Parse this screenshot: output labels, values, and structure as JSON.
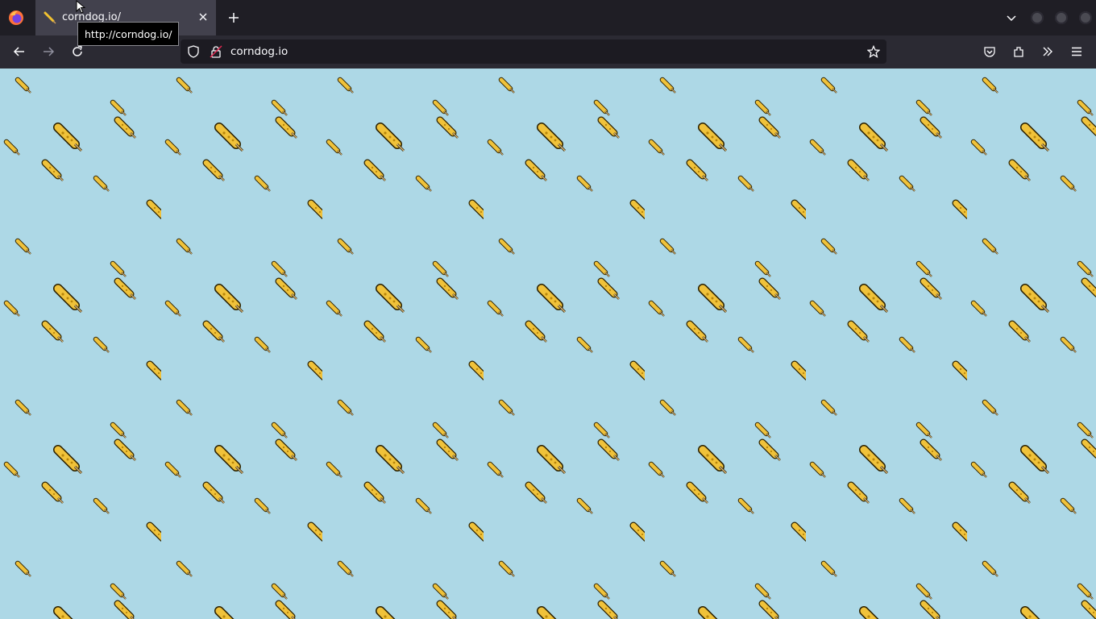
{
  "browser": {
    "tabs": [
      {
        "title": "corndog.io/",
        "favicon": "corndog-icon",
        "active": true
      }
    ],
    "tooltip": "http://corndog.io/",
    "address_bar": {
      "url": "corndog.io"
    },
    "toolbar_icons": [
      "back-icon",
      "forward-icon",
      "reload-icon",
      "shield-icon",
      "lock-icon",
      "bookmark-star-icon",
      "pocket-icon",
      "extensions-icon",
      "overflow-chevron-icon",
      "menu-icon"
    ]
  },
  "page": {
    "background_color": "#add8e6",
    "pattern_item": "corndog-icon"
  }
}
